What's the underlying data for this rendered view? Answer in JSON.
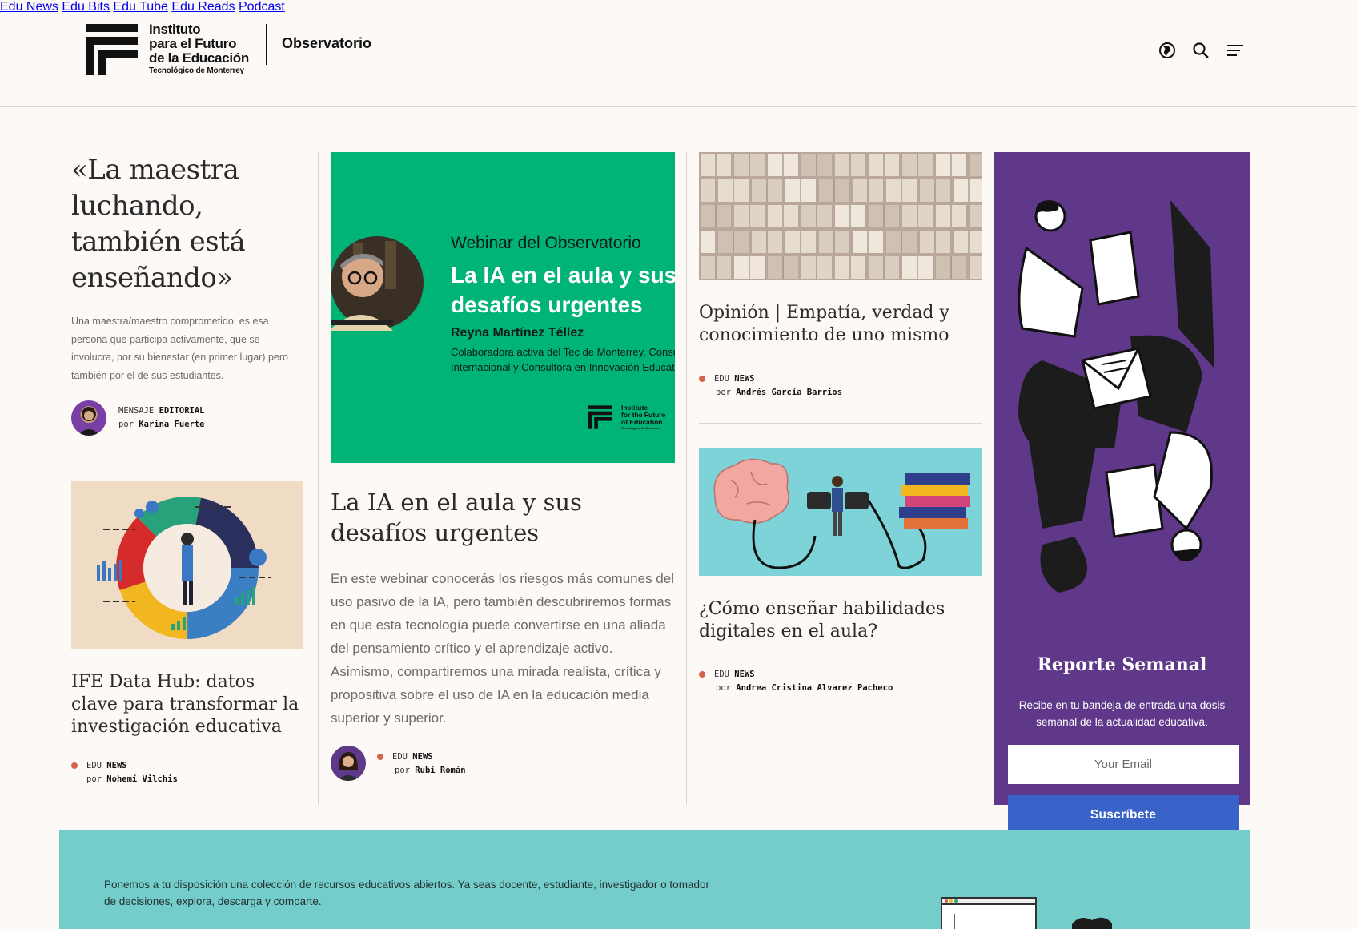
{
  "header": {
    "logo_lines": [
      "Instituto",
      "para el Futuro",
      "de la Educación"
    ],
    "logo_sub": "Tecnológico de Monterrey",
    "section_name": "Observatorio",
    "nav": [
      "Edu News",
      "Edu Bits",
      "Edu Tube",
      "Edu Reads",
      "Podcast"
    ],
    "icons": [
      "globe-icon",
      "search-icon",
      "menu-icon"
    ]
  },
  "col1": {
    "quote_title": "«La maestra luchando, también está enseñando»",
    "quote_desc": "Una maestra/maestro comprometido, es esa persona que participa activamente, que se involucra, por su bienestar (en primer lugar) pero también por el de sus estudiantes.",
    "quote_category_a": "MENSAJE",
    "quote_category_b": "EDITORIAL",
    "quote_by_prefix": "por",
    "quote_author": "Karina Fuerte",
    "card_title": "IFE Data Hub: datos clave para transformar la investigación educativa",
    "card_category_a": "EDU",
    "card_category_b": "NEWS",
    "card_by_prefix": "por",
    "card_author": "Nohemí Vilchis"
  },
  "col2": {
    "banner": {
      "overline": "Webinar del Observatorio",
      "title_line1": "La IA en el aula y sus",
      "title_line2": "desafíos urgentes",
      "speaker": "Reyna Martínez Téllez",
      "role_line1": "Colaboradora activa del Tec de Monterrey, Consultora",
      "role_line2": "Internacional y Consultora en Innovación Educativa",
      "logo_text": [
        "Institute",
        "for the Future",
        "of Education"
      ],
      "logo_sub": "Tecnológico de Monterrey"
    },
    "title": "La IA en el aula y sus desafíos urgentes",
    "desc": "En este webinar conocerás los riesgos más comunes del uso pasivo de la IA, pero también descubriremos formas en que esta tecnología puede convertirse en una aliada del pensamiento crítico y el aprendizaje activo. Asimismo, compartiremos una mirada realista, crítica y propositiva sobre el uso de IA en la educación media superior y superior.",
    "category_a": "EDU",
    "category_b": "NEWS",
    "by_prefix": "por",
    "author": "Rubí Román"
  },
  "col3": {
    "article1_title": "Opinión | Empatía, verdad y conocimiento de uno mismo",
    "article1_category_a": "EDU",
    "article1_category_b": "NEWS",
    "article1_by_prefix": "por",
    "article1_author": "Andrés García Barrios",
    "article2_title": "¿Cómo enseñar habilidades digitales en el aula?",
    "article2_category_a": "EDU",
    "article2_category_b": "NEWS",
    "article2_by_prefix": "por",
    "article2_author": "Andrea Cristina Alvarez Pacheco"
  },
  "newsletter": {
    "title": "Reporte Semanal",
    "desc": "Recibe en tu bandeja de entrada una dosis semanal de la actualidad educativa.",
    "email_placeholder": "Your Email",
    "button": "Suscríbete"
  },
  "banner": {
    "text": "Ponemos a tu disposición una colección de recursos educativos abiertos. Ya seas docente, estudiante, investigador o tomador de decisiones, explora, descarga y comparte."
  },
  "colors": {
    "background": "#fcf9f6",
    "newsletter_bg": "#5f3889",
    "button_blue": "#3a63c9",
    "webinar_green": "#00b377",
    "banner_teal": "#74cccb",
    "category_dot": "#d2654a"
  }
}
